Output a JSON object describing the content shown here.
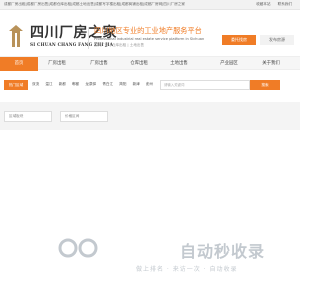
{
  "topbar": {
    "crumbs": "成都厂房出租|成都厂房出售|成都仓库出租|成都土地出售|成都写字楼出租|成都商铺出租|成都厂房网|四川厂房之家",
    "right_items": [
      "收藏本站",
      "联系我们"
    ]
  },
  "header": {
    "logo_cn": "四川厂房之家",
    "logo_en": "SI CHUAN CHANG FANG ZHI JIA",
    "slogan": "四川地区专业的工业地产服务平台",
    "slogan_en": "Professional industrial real estate service platform in Sichuan",
    "slogan_sub": "招商厂房 | 仓库出租 | 土地出售",
    "btn_primary": "委托找房",
    "btn_secondary": "发布房源"
  },
  "nav": {
    "items": [
      "首页",
      "厂房出租",
      "厂房出售",
      "仓库出租",
      "土地出售",
      "产业园区",
      "关于我们"
    ],
    "active_index": 0
  },
  "subnav": {
    "tag": "热门区域",
    "links": [
      "双流",
      "温江",
      "新都",
      "郫都",
      "龙泉驿",
      "青白江",
      "简阳",
      "新津",
      "彭州"
    ],
    "search_placeholder": "请输入关键词",
    "search_btn": "搜索"
  },
  "band": {
    "field_a": "区域板块",
    "field_b": "价格区间"
  },
  "watermark": {
    "text": "自动秒收录",
    "sub": "做上排名 · 来访一次 · 自动收录"
  },
  "colors": {
    "accent": "#f07c26",
    "nav_bg": "#f6f6f6",
    "band_bg": "#f4f4f4",
    "watermark": "#c3c9cf"
  }
}
